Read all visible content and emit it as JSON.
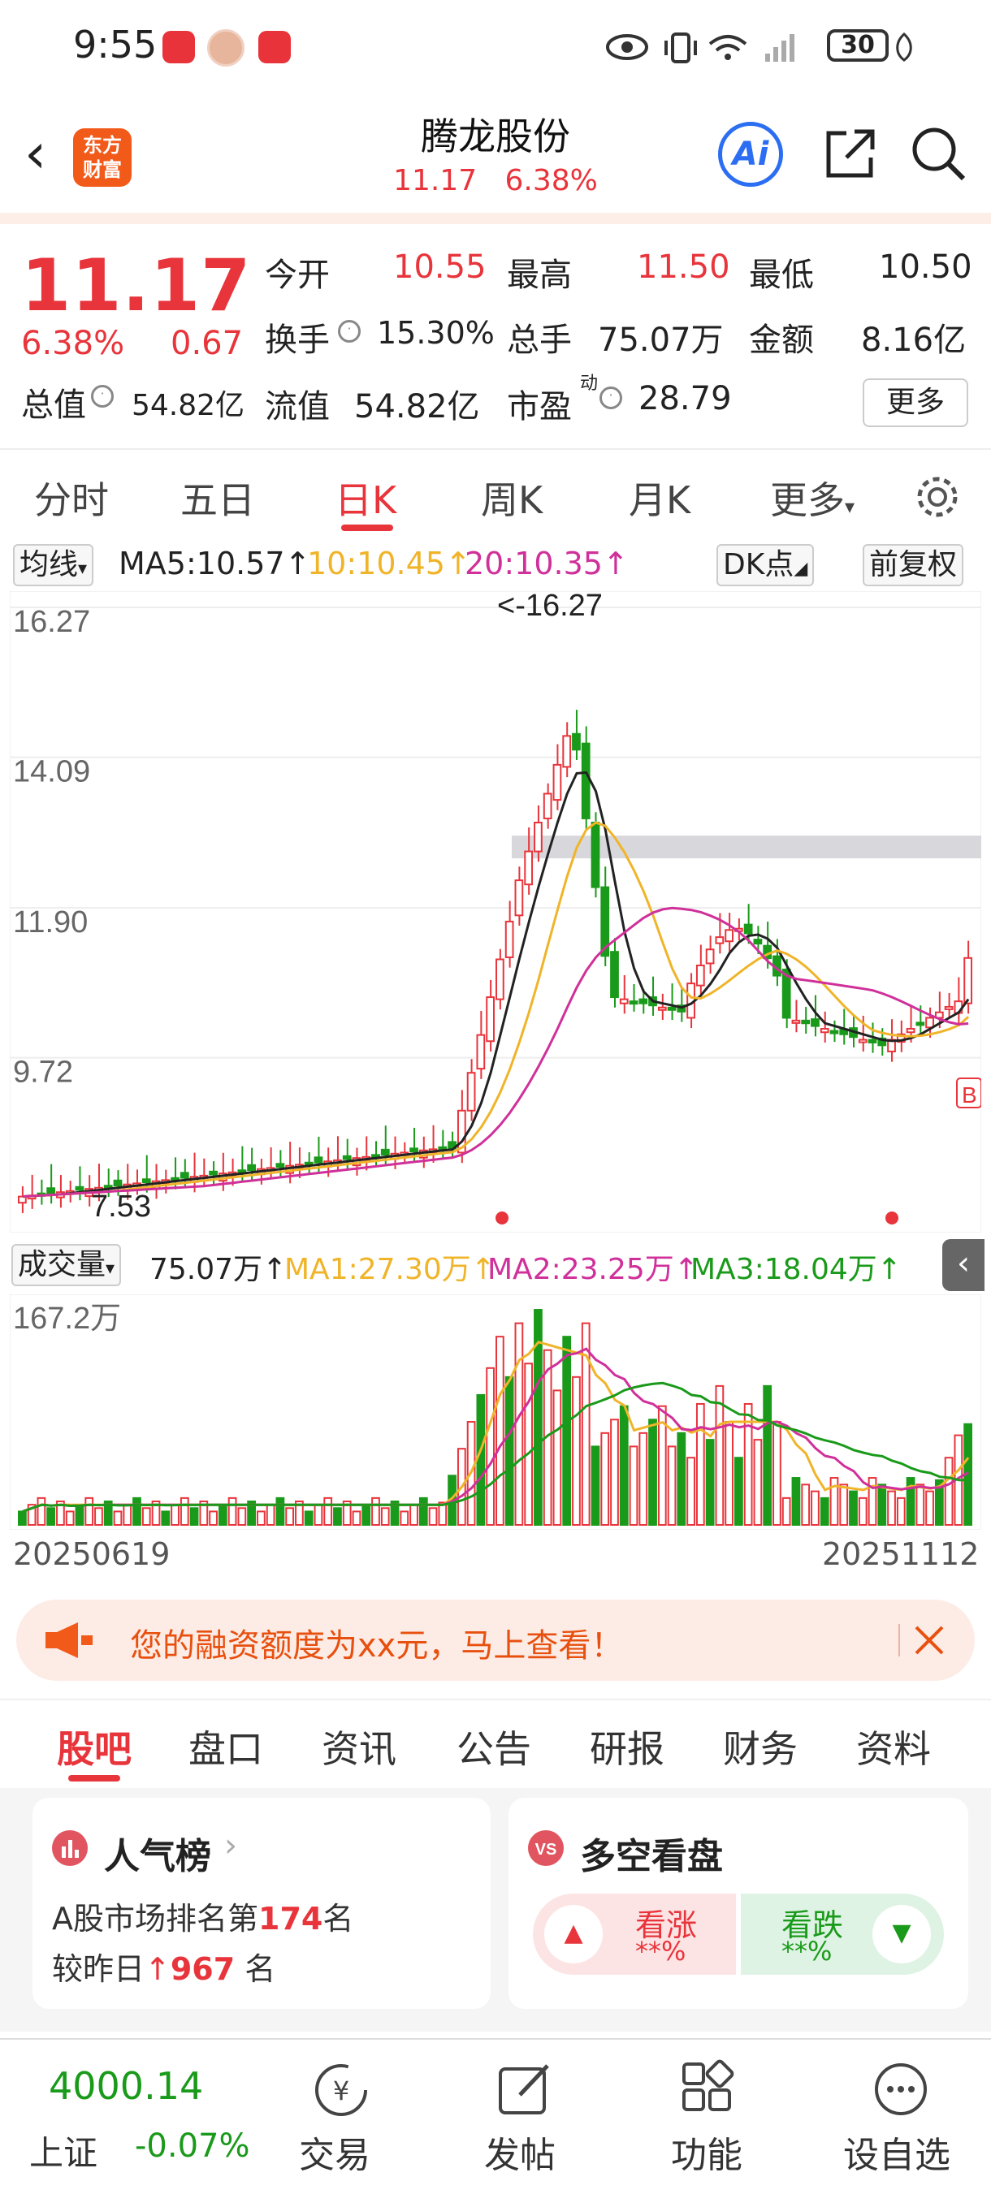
{
  "status_bar": {
    "time": "9:55",
    "battery": "30"
  },
  "header": {
    "name": "腾龙股份",
    "price": "11.17",
    "change_pct": "6.38%",
    "logo_line1": "东方",
    "logo_line2": "财富",
    "ai_label": "Ai"
  },
  "quote": {
    "price": "11.17",
    "change_pct": "6.38%",
    "change": "0.67",
    "open_label": "今开",
    "open": "10.55",
    "high_label": "最高",
    "high": "11.50",
    "low_label": "最低",
    "low": "10.50",
    "turnover_label": "换手",
    "turnover": "15.30%",
    "volume_label": "总手",
    "volume": "75.07万",
    "amount_label": "金额",
    "amount": "8.16亿",
    "mcap_label": "总值",
    "mcap": "54.82亿",
    "float_label": "流值",
    "float": "54.82亿",
    "pe_label": "市盈",
    "pe_sup": "动",
    "pe": "28.79",
    "more": "更多"
  },
  "period_tabs": [
    "分时",
    "五日",
    "日K",
    "周K",
    "月K",
    "更多"
  ],
  "active_period": "日K",
  "ma_row": {
    "selector": "均线",
    "ma5": "MA5:10.57↑",
    "ma10": "10:10.45↑",
    "ma20": "20:10.35↑",
    "dk": "DK点",
    "fq": "前复权"
  },
  "kchart": {
    "y_labels": [
      "16.27",
      "14.09",
      "11.90",
      "9.72"
    ],
    "high_note": "<-16.27",
    "low_note": "7.53",
    "b_mark": "B"
  },
  "vol_row": {
    "selector": "成交量",
    "vol": "75.07万↑",
    "ma1": "MA1:27.30万↑",
    "ma2": "MA2:23.25万↑",
    "ma3": "MA3:18.04万↑"
  },
  "vchart": {
    "max_label": "167.2万"
  },
  "dates": {
    "start": "20250619",
    "end": "20251112"
  },
  "banner": {
    "text": "您的融资额度为xx元，马上查看！"
  },
  "bottom_tabs": [
    "股吧",
    "盘口",
    "资讯",
    "公告",
    "研报",
    "财务",
    "资料"
  ],
  "rank_card": {
    "title": "人气榜",
    "line1_a": "A股市场排名第",
    "rank": "174",
    "line1_b": "名",
    "line2_a": "较昨日",
    "delta": "967",
    "line2_b": "名"
  },
  "vs_card": {
    "title": "多空看盘",
    "up_label": "看涨",
    "up_val": "**%",
    "down_label": "看跌",
    "down_val": "**%"
  },
  "footer": {
    "index_value": "4000.14",
    "index_name": "上证",
    "index_change": "-0.07%",
    "trade": "交易",
    "post": "发帖",
    "func": "功能",
    "watch": "设自选"
  },
  "colors": {
    "up": "#e8343b",
    "down": "#1a9a1a",
    "ma5": "#222222",
    "ma10": "#f0b429",
    "ma20": "#d0309a"
  },
  "chart_data": {
    "type": "candlestick",
    "price_axis": [
      "16.27",
      "14.09",
      "11.90",
      "9.72"
    ],
    "high": 16.27,
    "low": 7.53,
    "volume_max": "167.2万",
    "x_start": "20250619",
    "x_end": "20251112"
  }
}
